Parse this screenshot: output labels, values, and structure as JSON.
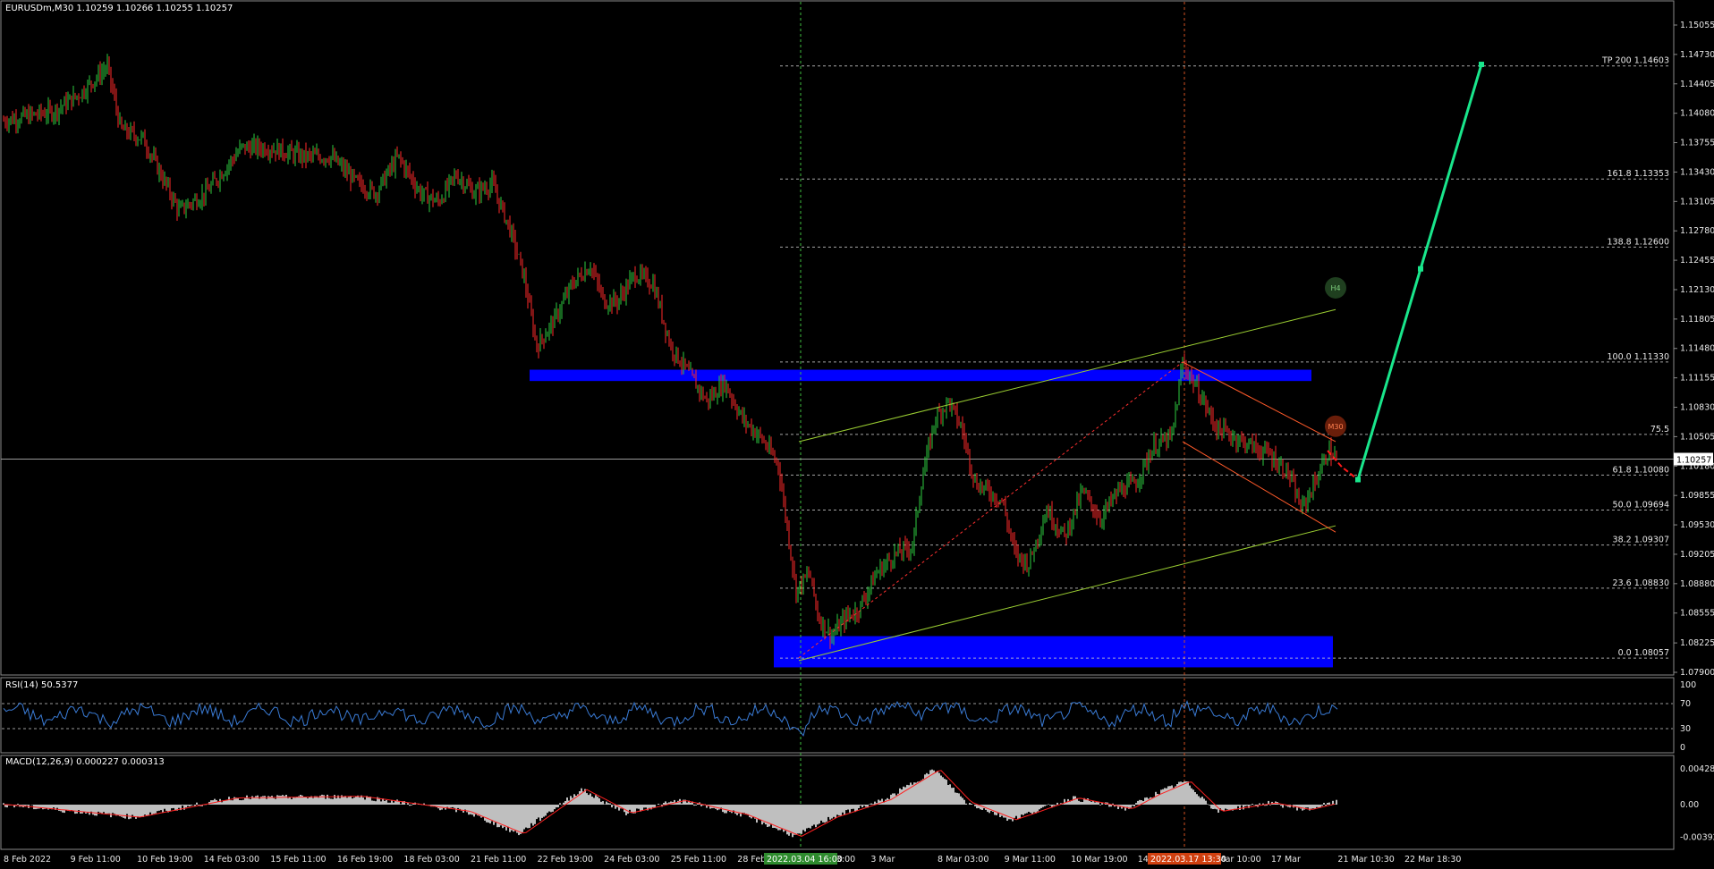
{
  "main_panel": {
    "title": "EURUSDm,M30  1.10259 1.10266 1.10255 1.10257",
    "current_price_label": "1.10257",
    "price_ticks": [
      "1.15055",
      "1.14730",
      "1.14405",
      "1.14080",
      "1.13755",
      "1.13430",
      "1.13105",
      "1.12780",
      "1.12455",
      "1.12130",
      "1.11805",
      "1.11480",
      "1.11155",
      "1.10830",
      "1.10505",
      "1.10180",
      "1.09855",
      "1.09530",
      "1.09205",
      "1.08880",
      "1.08555",
      "1.08225",
      "1.07900"
    ],
    "fib_levels": [
      {
        "label": "TP 200 1.14603",
        "price": 1.14603
      },
      {
        "label": "161.8 1.13353",
        "price": 1.13353
      },
      {
        "label": "138.8 1.12600",
        "price": 1.126
      },
      {
        "label": "100.0 1.11330",
        "price": 1.1133
      },
      {
        "label": "75.5",
        "price": 1.1053
      },
      {
        "label": "61.8 1.10080",
        "price": 1.1008
      },
      {
        "label": "50.0 1.09694",
        "price": 1.09694
      },
      {
        "label": "38.2 1.09307",
        "price": 1.09307
      },
      {
        "label": "23.6 1.08830",
        "price": 1.0883
      },
      {
        "label": "0.0 1.08057",
        "price": 1.08057
      }
    ],
    "badges": {
      "h4": "H4",
      "m30": "M30"
    },
    "colors": {
      "bull": "#2ecc40",
      "bear": "#ff2a2a",
      "zone": "#0000ff",
      "projection": "#19e68c",
      "channel": "#9acd32",
      "rsi": "#3a7bd5",
      "macd_signal": "#ff2020",
      "grid": "#cfcfcf",
      "border": "#8a8a8a"
    }
  },
  "rsi_panel": {
    "title": "RSI(14) 50.5377",
    "ticks": [
      "100",
      "70",
      "30",
      "0"
    ]
  },
  "macd_panel": {
    "title": "MACD(12,26,9) 0.000227 0.000313",
    "ticks": [
      "0.004283",
      "0.00",
      "-0.003921"
    ]
  },
  "time_axis": {
    "labels": [
      "8 Feb 2022",
      "9 Feb 11:00",
      "10 Feb 19:00",
      "14 Feb 03:00",
      "15 Feb 11:00",
      "16 Feb 19:00",
      "18 Feb 03:00",
      "21 Feb 11:00",
      "22 Feb 19:00",
      "24 Feb 03:00",
      "25 Feb 11:00",
      "28 Feb 19:00",
      "2 Mar 03:00",
      "3 Mar",
      "8 Mar 03:00",
      "9 Mar 11:00",
      "10 Mar 19:00",
      "14 Mar 02:00",
      "15 Mar 10:00",
      "17 Mar",
      "21 Mar 10:30",
      "22 Mar 18:30"
    ],
    "highlight_1": "2022.03.04 16:00",
    "highlight_2": "2022.03.17 13:30"
  }
}
